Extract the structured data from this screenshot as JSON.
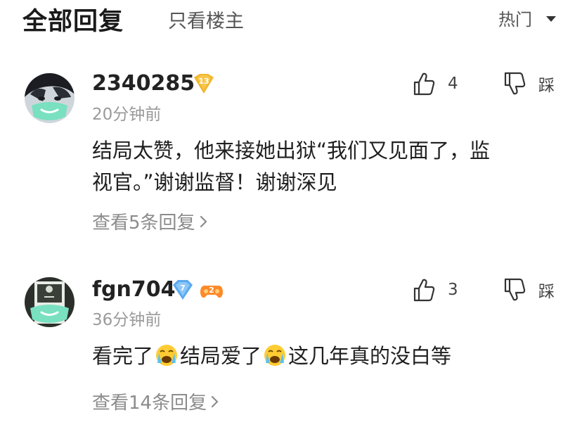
{
  "header": {
    "tab_all": "全部回复",
    "tab_op_only": "只看楼主",
    "sort": "热门"
  },
  "comments": [
    {
      "username": "2340285",
      "level": "13",
      "time": "20分钟前",
      "likes": "4",
      "dislike_label": "踩",
      "text_line1": "结局太赞，他来接她出狱“我们又见面了，监",
      "text_line2": "视官。”谢谢监督！谢谢深见",
      "replies_label": "查看5条回复"
    },
    {
      "username": "fgn704",
      "level": "7",
      "badge2": "2",
      "time": "36分钟前",
      "likes": "3",
      "dislike_label": "踩",
      "text_part1": "看完了",
      "text_part2": "结局爱了",
      "text_part3": "这几年真的没白等",
      "replies_label": "查看14条回复"
    }
  ],
  "colors": {
    "level_gold": "#f2b62b",
    "level_blue": "#5aa9f0",
    "mask_green": "#79e0c0"
  },
  "icons": [
    "thumbs-up-icon",
    "thumbs-down-icon",
    "chevron-right-icon",
    "caret-down-icon",
    "crying-emoji-icon",
    "gamepad-badge-icon"
  ]
}
